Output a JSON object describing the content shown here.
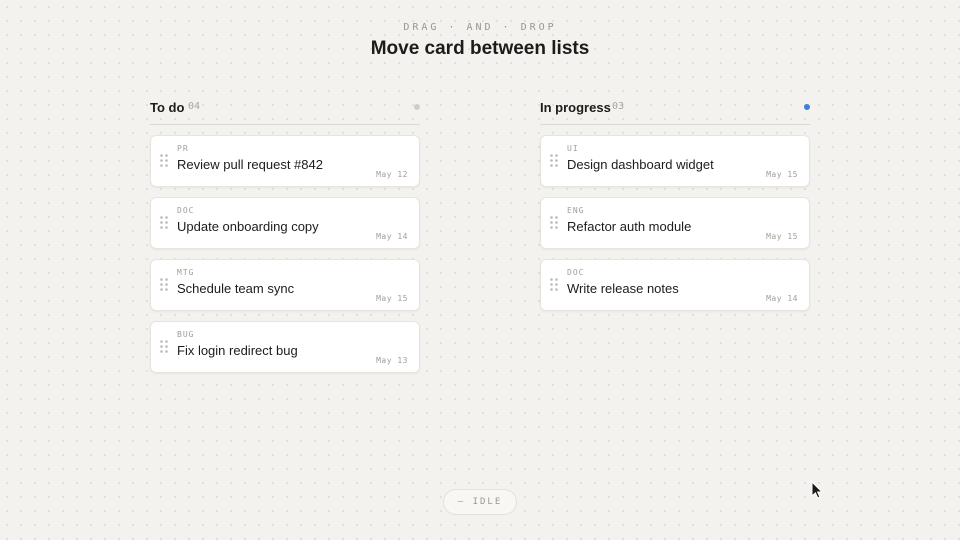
{
  "header": {
    "eyebrow": "DRAG · AND · DROP",
    "title": "Move card between lists"
  },
  "columns": [
    {
      "title": "To do",
      "count": "04",
      "indicator_color": "#cfcdc8",
      "cards": [
        {
          "tag": "PR",
          "title": "Review pull request #842",
          "date": "May 12"
        },
        {
          "tag": "DOC",
          "title": "Update onboarding copy",
          "date": "May 14"
        },
        {
          "tag": "MTG",
          "title": "Schedule team sync",
          "date": "May 15"
        },
        {
          "tag": "BUG",
          "title": "Fix login redirect bug",
          "date": "May 13"
        }
      ]
    },
    {
      "title": "In progress",
      "count": "03",
      "indicator_color": "#3b82d6",
      "cards": [
        {
          "tag": "UI",
          "title": "Design dashboard widget",
          "date": "May 15"
        },
        {
          "tag": "ENG",
          "title": "Refactor auth module",
          "date": "May 15"
        },
        {
          "tag": "DOC",
          "title": "Write release notes",
          "date": "May 14"
        }
      ]
    }
  ],
  "status": {
    "label": "— IDLE"
  },
  "icons": {
    "grip": "drag-handle-icon",
    "cursor": "mouse-pointer-icon"
  }
}
